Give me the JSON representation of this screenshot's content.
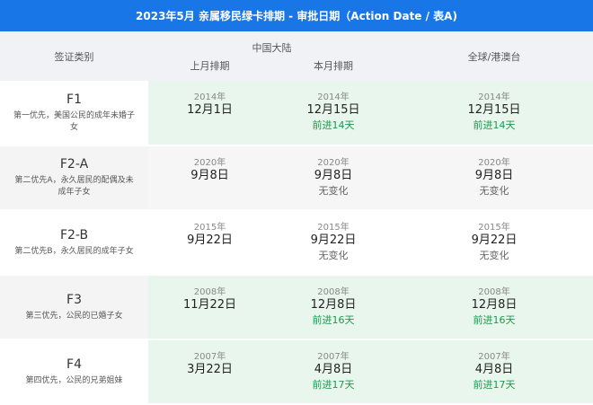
{
  "title": "2023年5月 亲属移民绿卡排期 - 审批日期（Action Date / 表A)",
  "header": {
    "category_col": "签证类别",
    "china_group": "中国大陆",
    "last_month": "上月排期",
    "this_month": "本月排期",
    "global": "全球/港澳台"
  },
  "rows": [
    {
      "code": "F1",
      "desc": "第一优先，美国公民的成年未婚子女",
      "last": {
        "year": "2014年",
        "date": "12月1日"
      },
      "this": {
        "year": "2014年",
        "date": "12月15日",
        "status": "前进14天"
      },
      "global": {
        "year": "2014年",
        "date": "12月15日",
        "status": "前进14天"
      }
    },
    {
      "code": "F2-A",
      "desc": "第二优先A，永久居民的配偶及未成年子女",
      "last": {
        "year": "2020年",
        "date": "9月8日"
      },
      "this": {
        "year": "2020年",
        "date": "9月8日",
        "status": "无变化"
      },
      "global": {
        "year": "2020年",
        "date": "9月8日",
        "status": "无变化"
      }
    },
    {
      "code": "F2-B",
      "desc": "第二优先B，永久居民的成年子女",
      "last": {
        "year": "2015年",
        "date": "9月22日"
      },
      "this": {
        "year": "2015年",
        "date": "9月22日",
        "status": "无变化"
      },
      "global": {
        "year": "2015年",
        "date": "9月22日",
        "status": "无变化"
      }
    },
    {
      "code": "F3",
      "desc": "第三优先，公民的已婚子女",
      "last": {
        "year": "2008年",
        "date": "11月22日"
      },
      "this": {
        "year": "2008年",
        "date": "12月8日",
        "status": "前进16天"
      },
      "global": {
        "year": "2008年",
        "date": "12月8日",
        "status": "前进16天"
      }
    },
    {
      "code": "F4",
      "desc": "第四优先，公民的兄弟姐妹",
      "last": {
        "year": "2007年",
        "date": "3月22日"
      },
      "this": {
        "year": "2007年",
        "date": "4月8日",
        "status": "前进17天"
      },
      "global": {
        "year": "2007年",
        "date": "4月8日",
        "status": "前进17天"
      }
    }
  ],
  "colors": {
    "title_bg": "#1976e6",
    "advance": "#1a9a4a",
    "advance_bg": "#e9f6ee",
    "nochange_bg": "#f6f6f6"
  }
}
